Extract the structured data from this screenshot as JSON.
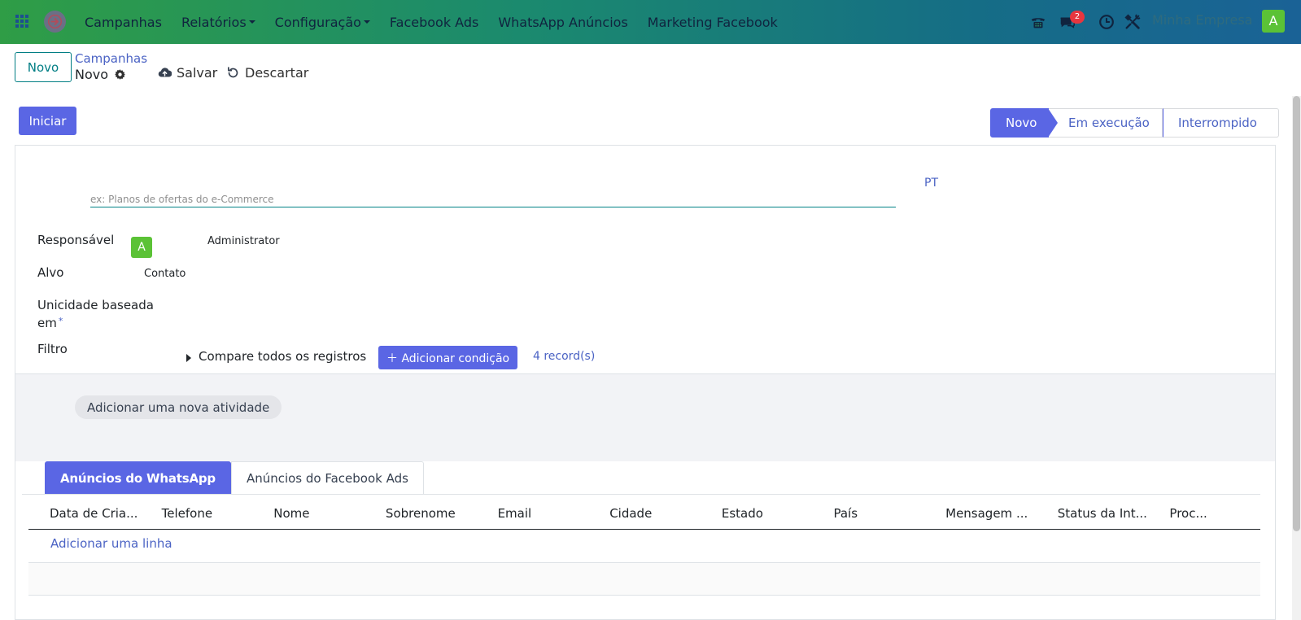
{
  "navbar": {
    "menu": [
      {
        "label": "Campanhas",
        "dropdown": false
      },
      {
        "label": "Relatórios",
        "dropdown": true
      },
      {
        "label": "Configuração",
        "dropdown": true
      },
      {
        "label": "Facebook Ads",
        "dropdown": false
      },
      {
        "label": "WhatsApp Anúncios",
        "dropdown": false
      },
      {
        "label": "Marketing Facebook",
        "dropdown": false
      }
    ],
    "messages_badge": "2",
    "company": "Minha Empresa",
    "user_initial": "A",
    "icons": [
      "apps-grid-icon",
      "brand-arrow-icon",
      "phone-icon",
      "chat-icon",
      "clock-icon",
      "tools-icon"
    ]
  },
  "control_panel": {
    "new_button": "Novo",
    "breadcrumb_parent": "Campanhas",
    "breadcrumb_current": "Novo",
    "save_label": "Salvar",
    "discard_label": "Descartar"
  },
  "header": {
    "start_button": "Iniciar",
    "stages": [
      "Novo",
      "Em execução",
      "Interrompido"
    ],
    "active_stage": "Novo"
  },
  "form": {
    "name_placeholder": "ex: Planos de ofertas do e-Commerce",
    "lang": "PT",
    "fields": {
      "responsavel_label": "Responsável",
      "responsavel_initial": "A",
      "responsavel_value": "Administrator",
      "alvo_label": "Alvo",
      "alvo_value": "Contato",
      "unicidade_label_1": "Unicidade baseada",
      "unicidade_label_2": "em",
      "required_mark": "*",
      "filtro_label": "Filtro",
      "filtro_text": "Compare todos os registros",
      "add_condition": "Adicionar condição",
      "record_count": "4 record(s)"
    },
    "add_activity": "Adicionar uma nova atividade"
  },
  "tabs": [
    "Anúncios do WhatsApp",
    "Anúncios do Facebook Ads"
  ],
  "table": {
    "columns": [
      "Data de Cria...",
      "Telefone",
      "Nome",
      "Sobrenome",
      "Email",
      "Cidade",
      "Estado",
      "País",
      "Mensagem ...",
      "Status da Int...",
      "Proc..."
    ],
    "add_line": "Adicionar uma linha"
  },
  "colors": {
    "primary": "#5a66e4",
    "accent_teal": "#017e84",
    "link": "#4b63c4",
    "avatar_green": "#5bc236",
    "badge_red": "#e7363f"
  }
}
